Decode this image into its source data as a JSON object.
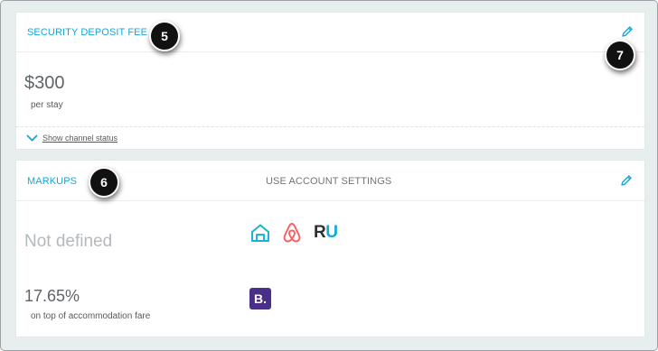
{
  "security_deposit": {
    "title": "SECURITY DEPOSIT FEE",
    "amount": "$300",
    "unit": "per stay",
    "channel_link": "Show channel status"
  },
  "markups": {
    "title": "MARKUPS",
    "account_setting": "USE ACCOUNT SETTINGS",
    "not_defined": "Not defined",
    "percent": "17.65%",
    "percent_desc": "on top of accommodation fare",
    "channel_icons_row1": [
      "homeaway-icon",
      "airbnb-icon",
      "rentals-united-icon"
    ],
    "channel_icons_row2": [
      "booking-icon"
    ],
    "ru_logo_r": "R",
    "ru_logo_u": "U",
    "booking_logo": "B."
  },
  "callouts": {
    "five": "5",
    "six": "6",
    "seven": "7"
  },
  "colors": {
    "accent": "#10a9d6",
    "background": "#e7eeee",
    "booking": "#4a2f89",
    "airbnb": "#ff5a5f"
  }
}
